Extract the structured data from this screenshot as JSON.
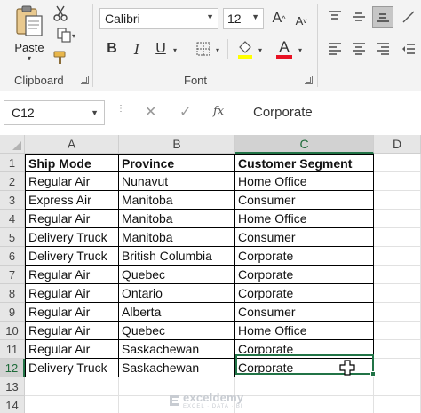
{
  "ribbon": {
    "clipboard": {
      "group_label": "Clipboard",
      "paste_label": "Paste",
      "cut_icon": "scissors-icon",
      "copy_icon": "copy-icon",
      "format_painter_icon": "paintbrush-icon"
    },
    "font": {
      "group_label": "Font",
      "font_name": "Calibri",
      "font_size": "12",
      "grow_label": "A",
      "shrink_label": "A",
      "bold_label": "B",
      "italic_label": "I",
      "underline_label": "U",
      "font_color_label": "A",
      "font_color": "#e81123",
      "fill_color": "#ffff00"
    }
  },
  "formula_bar": {
    "name_box": "C12",
    "fx_label": "fx",
    "formula": "Corporate"
  },
  "sheet": {
    "columns": [
      "A",
      "B",
      "C",
      "D"
    ],
    "active_column": "C",
    "active_row": "12",
    "rows": [
      {
        "num": "1",
        "cells": [
          "Ship Mode",
          "Province",
          "Customer Segment"
        ]
      },
      {
        "num": "2",
        "cells": [
          "Regular Air",
          "Nunavut",
          "Home Office"
        ]
      },
      {
        "num": "3",
        "cells": [
          "Express Air",
          "Manitoba",
          "Consumer"
        ]
      },
      {
        "num": "4",
        "cells": [
          "Regular Air",
          "Manitoba",
          "Home Office"
        ]
      },
      {
        "num": "5",
        "cells": [
          "Delivery Truck",
          "Manitoba",
          "Consumer"
        ]
      },
      {
        "num": "6",
        "cells": [
          "Delivery Truck",
          "British Columbia",
          "Corporate"
        ]
      },
      {
        "num": "7",
        "cells": [
          "Regular Air",
          "Quebec",
          "Corporate"
        ]
      },
      {
        "num": "8",
        "cells": [
          "Regular Air",
          "Ontario",
          "Corporate"
        ]
      },
      {
        "num": "9",
        "cells": [
          "Regular Air",
          "Alberta",
          "Consumer"
        ]
      },
      {
        "num": "10",
        "cells": [
          "Regular Air",
          "Quebec",
          "Home Office"
        ]
      },
      {
        "num": "11",
        "cells": [
          "Regular Air",
          "Saskachewan",
          "Corporate"
        ]
      },
      {
        "num": "12",
        "cells": [
          "Delivery Truck",
          "Saskachewan",
          "Corporate"
        ]
      },
      {
        "num": "13",
        "cells": [
          "",
          "",
          ""
        ]
      },
      {
        "num": "14",
        "cells": [
          "",
          "",
          ""
        ]
      }
    ],
    "accent_color": "#217346"
  },
  "watermark": {
    "name": "exceldemy",
    "tagline": "EXCEL · DATA · BI"
  }
}
